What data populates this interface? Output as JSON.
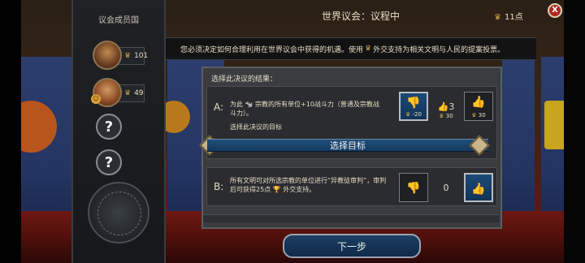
{
  "window": {
    "title": "世界议会：议程中",
    "points": "11点",
    "close_label": "X"
  },
  "sidebar": {
    "title": "议会成员国",
    "members": [
      {
        "votes": "101"
      },
      {
        "votes": "49"
      }
    ],
    "unknown_label": "?"
  },
  "notice": {
    "text_before": "您必须决定如何合理利用在世界议会中获得的机遇。使用",
    "text_after": "外交支持为相关文明与人民的提案投票。"
  },
  "panel": {
    "heading": "选择此决议的结果：",
    "option_a": {
      "letter": "A:",
      "text": "为此 🐄 宗教的所有单位+10战斗力（普通及宗教战斗力）。",
      "subheading": "选择此决议的目标",
      "target_button": "选择目标",
      "votes": {
        "down_cost": "-20",
        "count": "3",
        "count_cost": "30",
        "up_cost": "30"
      }
    },
    "option_b": {
      "letter": "B:",
      "text": "所有文明可对所选宗教的单位进行“异教徒审判”，审判后可获得25点 🏆 外交支持。",
      "votes": {
        "count": "0"
      }
    }
  },
  "footer": {
    "next_label": "下一步"
  },
  "icons": {
    "diplomatic": "medal-icon",
    "thumb_down": "thumb-down-icon",
    "thumb_up": "thumb-up-icon"
  },
  "colors": {
    "accent_blue": "#1c4a78",
    "gold": "#c9a24a",
    "close_red": "#b22a22"
  }
}
